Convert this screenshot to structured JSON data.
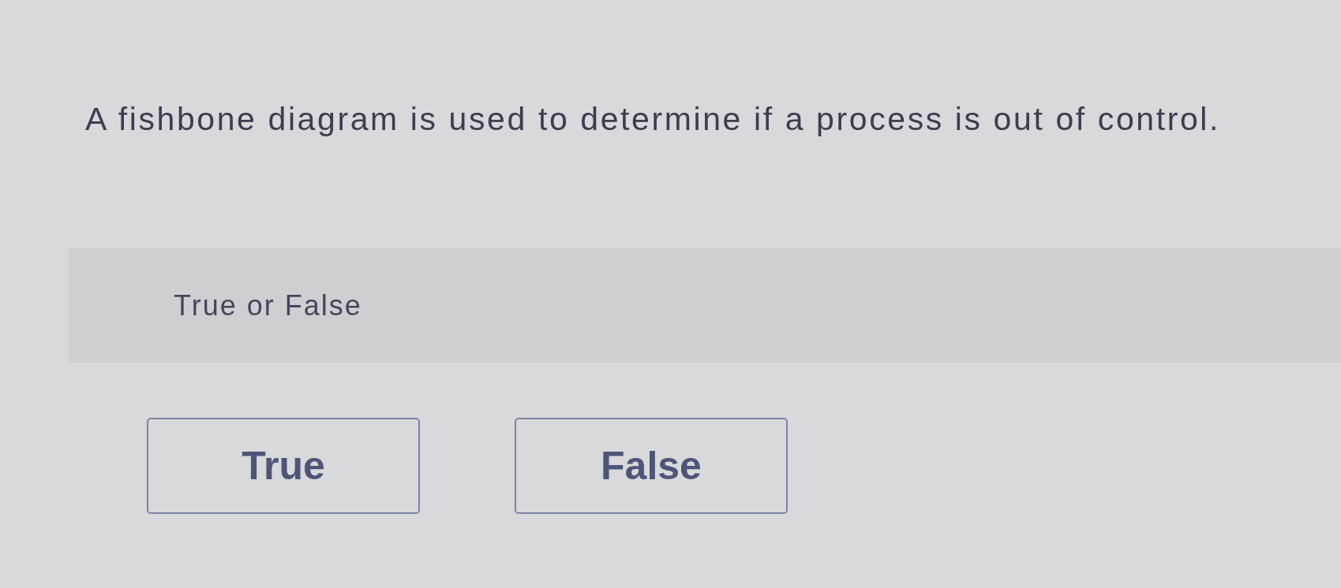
{
  "question": {
    "text": "A fishbone diagram is used to determine if a process is out of control."
  },
  "prompt": {
    "text": "True or False"
  },
  "answers": [
    {
      "label": "True",
      "selected": false
    },
    {
      "label": "False",
      "selected": false
    }
  ]
}
